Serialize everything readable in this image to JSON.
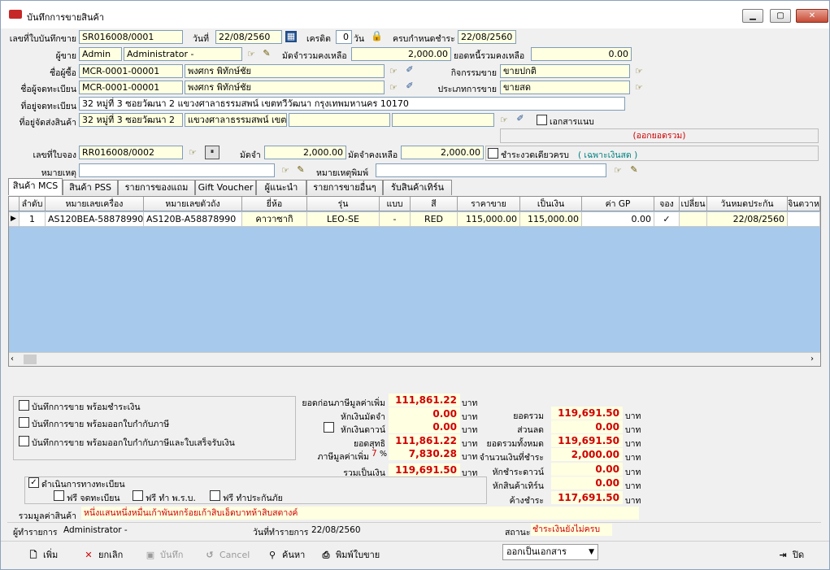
{
  "window": {
    "title": "บันทึกการขายสินค้า",
    "min": "▁",
    "max": "▢",
    "close": "✕"
  },
  "header": {
    "doc_no_label": "เลขที่ใบบันทึกขาย",
    "doc_no": "SR016008/0001",
    "date_label": "วันที่",
    "date": "22/08/2560",
    "credit_label": "เครดิต",
    "credit": "0",
    "credit_unit": "วัน",
    "due_label": "ครบกำหนดชำระ",
    "due": "22/08/2560",
    "seller_label": "ผู้ขาย",
    "seller_code": "Admin",
    "seller_name": "Administrator -",
    "deposit_balance_label": "มัดจำรวมคงเหลือ",
    "deposit_balance": "2,000.00",
    "debt_label": "ยอดหนี้รวมคงเหลือ",
    "debt": "0.00",
    "buyer_label": "ชื่อผู้ซื้อ",
    "buyer_code": "MCR-0001-00001",
    "buyer_name": "พงศกร พิทักษ์ชัย",
    "activity_label": "กิจกรรมขาย",
    "activity": "ขายปกติ",
    "registrant_label": "ชื่อผู้จดทะเบียน",
    "registrant_code": "MCR-0001-00001",
    "registrant_name": "พงศกร พิทักษ์ชัย",
    "sale_type_label": "ประเภทการขาย",
    "sale_type": "ขายสด",
    "reg_addr_label": "ที่อยู่จดทะเบียน",
    "reg_addr": "32 หมู่ที่ 3 ซอยวัฒนา 2 แขวงศาลาธรรมสพน์ เขตทวีวัฒนา กรุงเทพมหานคร 10170",
    "ship_addr_label": "ที่อยู่จัดส่งสินค้า",
    "ship_addr1": "32 หมู่ที่ 3 ซอยวัฒนา 2",
    "ship_addr2": "แขวงศาลาธรรมสพน์ เขตท",
    "attach_label": "เอกสารแนบ",
    "tax_invoice_note": "(ออกยอดรวม)",
    "booking_label": "เลขที่ใบจอง",
    "booking": "RR016008/0002",
    "deposit_label": "มัดจำ",
    "deposit": "2,000.00",
    "deposit_remain_label": "มัดจำคงเหลือ",
    "deposit_remain": "2,000.00",
    "onetime_label": "ชำระงวดเดียวครบ",
    "cash_only": "( เฉพาะเงินสด )",
    "note_label": "หมายเหตุ",
    "note": "",
    "print_note_label": "หมายเหตุพิมพ์",
    "print_note": ""
  },
  "tabs": [
    "สินค้า MCS",
    "สินค้า PSS",
    "รายการของแถม",
    "Gift Voucher",
    "ผู้แนะนำ",
    "รายการขายอื่นๆ",
    "รับสินค้าเทิร์น"
  ],
  "grid": {
    "headers": [
      "ลำดับ",
      "หมายเลขเครื่อง",
      "หมายเลขตัวถัง",
      "ยี่ห้อ",
      "รุ่น",
      "แบบ",
      "สี",
      "ราคาขาย",
      "เป็นเงิน",
      "ค่า GP",
      "จอง",
      "เปลี่ยน",
      "วันหมดประกัน",
      "จินตวาห"
    ],
    "rows": [
      [
        "1",
        "AS120BEA-58878990",
        "AS120B-A58878990",
        "คาวาซากิ",
        "LEO-SE",
        "-",
        "RED",
        "115,000.00",
        "115,000.00",
        "0.00",
        "✓",
        "",
        "22/08/2560",
        ""
      ]
    ]
  },
  "options": {
    "opt1": "บันทึกการขาย พร้อมชำระเงิน",
    "opt2": "บันทึกการขาย พร้อมออกใบกำกับภาษี",
    "opt3": "บันทึกการขาย พร้อมออกใบกำกับภาษีและใบเสร็จรับเงิน",
    "registration": "ดำเนินการทางทะเบียน",
    "free_reg": "ฟรี จดทะเบียน",
    "free_act": "ฟรี ทำ พ.ร.บ.",
    "free_ins": "ฟรี ทำประกันภัย"
  },
  "summary": {
    "pre_vat_label": "ยอดก่อนภาษีมูลค่าเพิ่ม",
    "pre_vat": "111,861.22",
    "deduct_deposit_label": "หักเงินมัดจำ",
    "deduct_deposit": "0.00",
    "deduct_down_label": "หักเงินดาวน์",
    "deduct_down": "0.00",
    "net_label": "ยอดสุทธิ",
    "net": "111,861.22",
    "vat_label": "ภาษีมูลค่าเพิ่ม",
    "vat_rate": "7",
    "vat": "7,830.28",
    "total_label": "รวมเป็นเงิน",
    "total": "119,691.50",
    "grand_label": "ยอดรวม",
    "grand": "119,691.50",
    "discount_label": "ส่วนลด",
    "discount": "0.00",
    "all_label": "ยอดรวมทั้งหมด",
    "all": "119,691.50",
    "to_pay_label": "จำนวนเงินที่ชำระ",
    "to_pay": "2,000.00",
    "down_pay_label": "หักชำระดาวน์",
    "down_pay": "0.00",
    "turn_label": "หักสินค้าเทิร์น",
    "turn": "0.00",
    "outstanding_label": "ค้างชำระ",
    "outstanding": "117,691.50",
    "unit": "บาท",
    "pct": "%"
  },
  "total_text_label": "รวมมูลค่าสินค้า",
  "total_text": "หนึ่งแสนหนึ่งหมื่นเก้าพันหกร้อยเก้าสิบเอ็ดบาทห้าสิบสตางค์",
  "status": {
    "by_label": "ผู้ทำรายการ",
    "by": "Administrator -",
    "date_label": "วันที่ทำรายการ",
    "date": "22/08/2560",
    "state_label": "สถานะ",
    "state": "ชำระเงินยังไม่ครบ"
  },
  "toolbar": {
    "add": "เพิ่ม",
    "cancel_doc": "ยกเลิก",
    "save": "บันทึก",
    "cancel": "Cancel",
    "search": "ค้นหา",
    "print": "พิมพ์ใบขาย",
    "export": "ออกเป็นเอกสาร",
    "close": "ปิด"
  }
}
